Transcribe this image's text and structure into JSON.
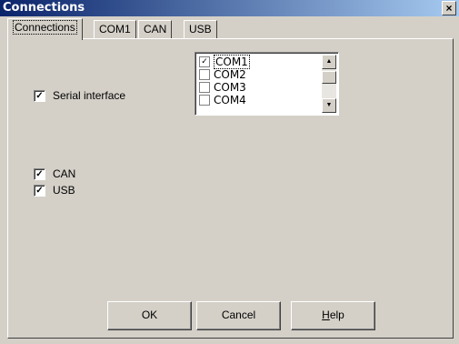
{
  "window": {
    "title": "Connections",
    "close_glyph": "×"
  },
  "tabs": [
    {
      "label": "Connections",
      "active": true
    },
    {
      "label": "COM1"
    },
    {
      "label": "CAN"
    },
    {
      "label": "USB"
    }
  ],
  "options": {
    "serial_interface": {
      "label": "Serial interface",
      "checked": true
    },
    "can": {
      "label": "CAN",
      "checked": true
    },
    "usb": {
      "label": "USB",
      "checked": true
    }
  },
  "port_list": {
    "items": [
      {
        "label": "COM1",
        "checked": true
      },
      {
        "label": "COM2",
        "checked": false
      },
      {
        "label": "COM3",
        "checked": false
      },
      {
        "label": "COM4",
        "checked": false
      }
    ]
  },
  "buttons": {
    "ok": "OK",
    "cancel": "Cancel",
    "help_underlined": "H",
    "help_rest": "elp"
  },
  "glyphs": {
    "check": "✓",
    "scroll_up": "▲",
    "scroll_down": "▼"
  }
}
